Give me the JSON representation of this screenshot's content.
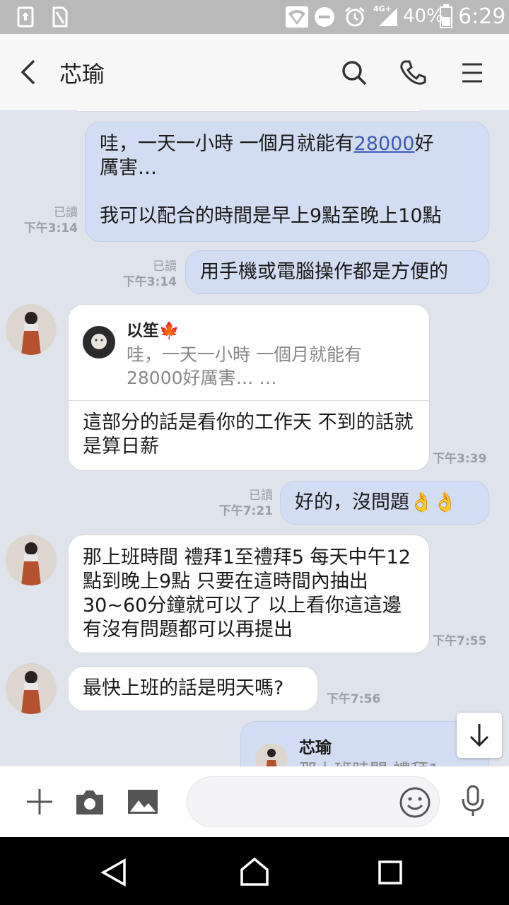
{
  "status_bar": {
    "battery_text": "40%",
    "time": "6:29",
    "network_label": "4G+",
    "icons": [
      "upload-icon",
      "sim-icon",
      "wifi-icon",
      "dnd-icon",
      "alarm-icon",
      "signal-icon",
      "battery-icon"
    ]
  },
  "header": {
    "title": "芯瑜",
    "icons": [
      "back-icon",
      "search-icon",
      "phone-icon",
      "menu-icon"
    ]
  },
  "messages": [
    {
      "id": "m1",
      "side": "sent",
      "line1_pre": "哇，一天一小時 一個月就能有",
      "line1_link": "28000",
      "line1_post": "好",
      "line2": "厲害…",
      "line3": "我可以配合的時間是早上9點至晚上10點",
      "read": "已讀",
      "time": "下午3:14"
    },
    {
      "id": "m2",
      "side": "sent",
      "text": "用手機或電腦操作都是方便的",
      "read": "已讀",
      "time": "下午3:14"
    },
    {
      "id": "m3",
      "side": "received",
      "reply_name": "以笙🍁",
      "reply_text": "哇，一天一小時 一個月就能有28000好厲害… …",
      "text": "這部分的話是看你的工作天 不到的話就是算日薪",
      "time": "下午3:39"
    },
    {
      "id": "m4",
      "side": "sent",
      "text": "好的，沒問題👌👌",
      "read": "已讀",
      "time": "下午7:21"
    },
    {
      "id": "m5",
      "side": "received",
      "text": "那上班時間 禮拜1至禮拜5 每天中午12點到晚上9點 只要在這時間內抽出30~60分鐘就可以了 以上看你這這邊有沒有問題都可以再提出",
      "time": "下午7:55"
    },
    {
      "id": "m6",
      "side": "received",
      "text": "最快上班的話是明天嗎?",
      "time": "下午7:56"
    },
    {
      "id": "m7",
      "side": "sent",
      "reply_name": "芯瑜",
      "reply_text": "那上班時間 禮拜1"
    }
  ],
  "input_bar": {
    "icons": [
      "plus-icon",
      "camera-icon",
      "image-icon",
      "emoji-icon",
      "microphone-icon"
    ],
    "placeholder": ""
  },
  "nav_bar": {
    "icons": [
      "back-nav-icon",
      "home-nav-icon",
      "recents-nav-icon"
    ]
  },
  "colors": {
    "sent_bubble": "#d2ddf3",
    "received_bubble": "#ffffff",
    "chat_background": "#dfe3ec",
    "link": "#3b5bb5"
  }
}
